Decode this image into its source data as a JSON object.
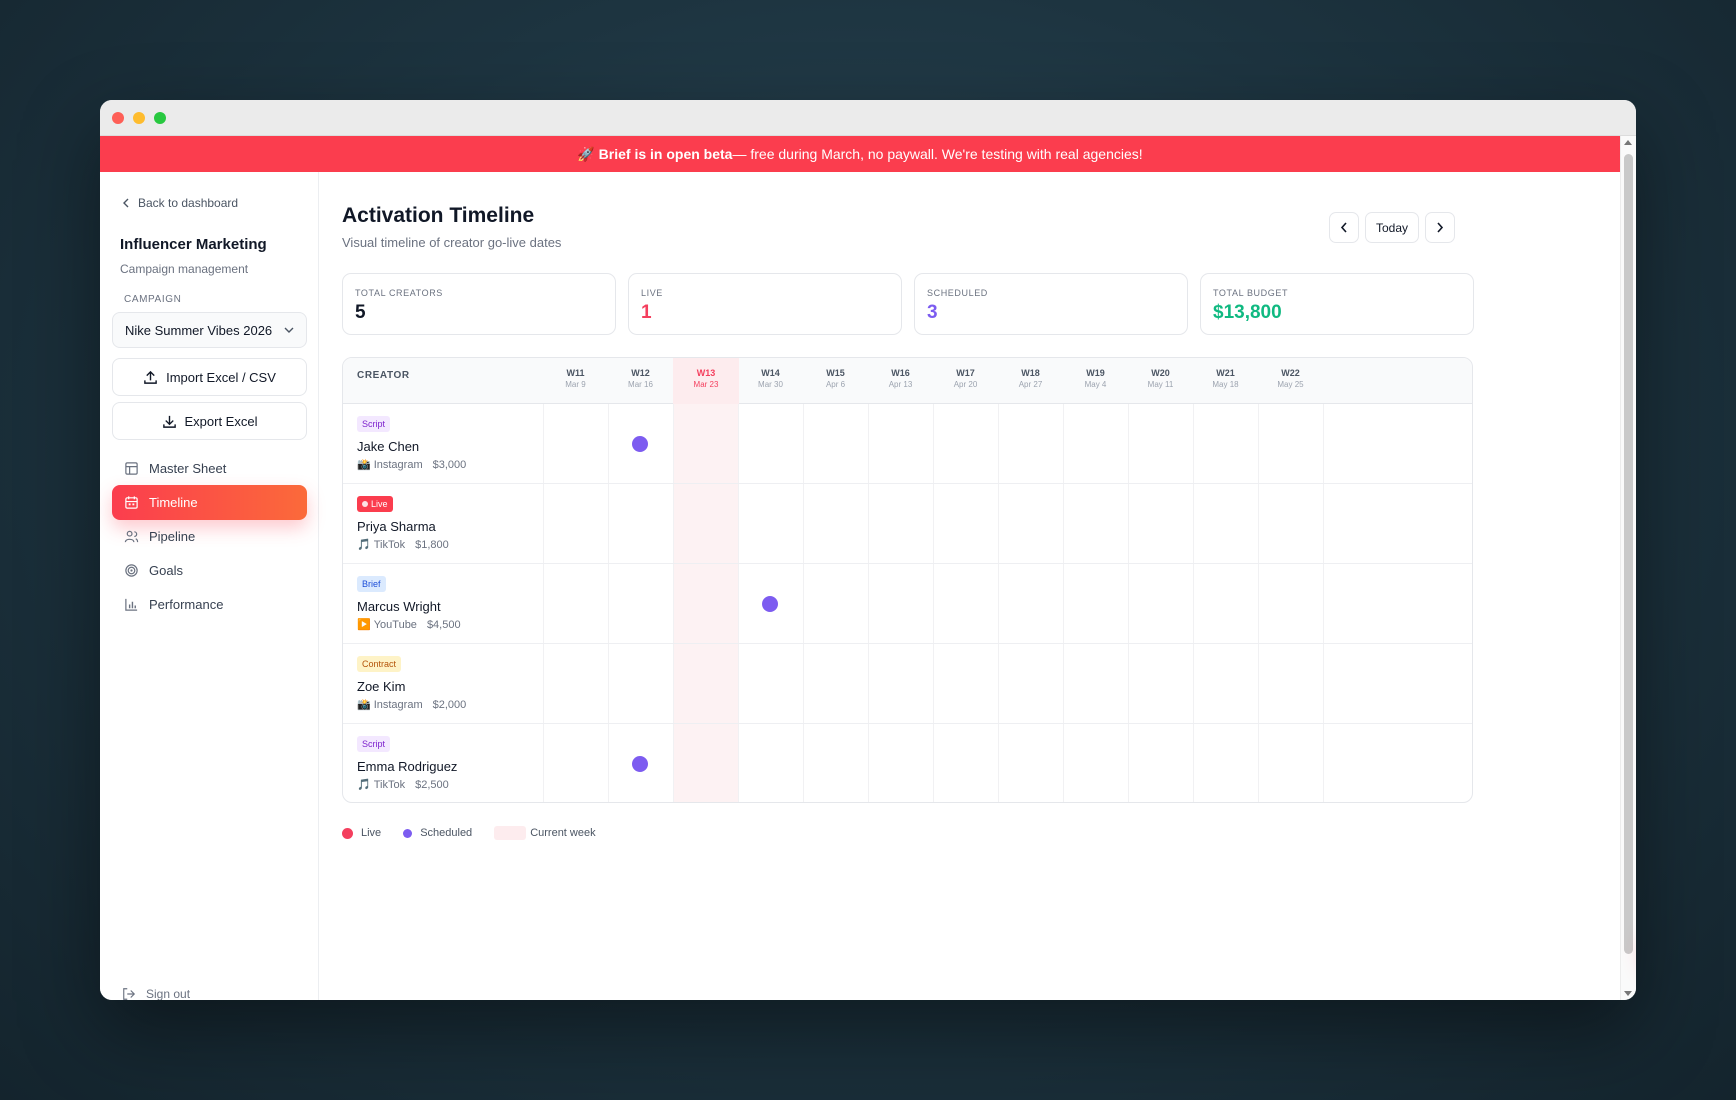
{
  "banner": {
    "emoji": "🚀",
    "bold": "Brief is in open beta",
    "rest": " — free during March, no paywall. We're testing with real agencies!"
  },
  "sidebar": {
    "back": "Back to dashboard",
    "title": "Influencer Marketing",
    "subtitle": "Campaign management",
    "campaign_label": "CAMPAIGN",
    "campaign_value": "Nike Summer Vibes 2026",
    "import_label": "Import Excel / CSV",
    "export_label": "Export Excel",
    "nav": [
      {
        "label": "Master Sheet",
        "icon": "table-icon",
        "active": false
      },
      {
        "label": "Timeline",
        "icon": "calendar-icon",
        "active": true
      },
      {
        "label": "Pipeline",
        "icon": "users-icon",
        "active": false
      },
      {
        "label": "Goals",
        "icon": "target-icon",
        "active": false
      },
      {
        "label": "Performance",
        "icon": "bar-chart-icon",
        "active": false
      }
    ],
    "signout": "Sign out"
  },
  "header": {
    "title": "Activation Timeline",
    "subtitle": "Visual timeline of creator go-live dates",
    "today": "Today"
  },
  "stats": [
    {
      "label": "TOTAL CREATORS",
      "value": "5",
      "color": "#111827"
    },
    {
      "label": "LIVE",
      "value": "1",
      "color": "#f43f5e"
    },
    {
      "label": "SCHEDULED",
      "value": "3",
      "color": "#7c5cf0"
    },
    {
      "label": "TOTAL BUDGET",
      "value": "$13,800",
      "color": "#10b981"
    }
  ],
  "timeline": {
    "creator_header": "CREATOR",
    "current_week": 2,
    "weeks": [
      {
        "w": "W11",
        "d": "Mar 9"
      },
      {
        "w": "W12",
        "d": "Mar 16"
      },
      {
        "w": "W13",
        "d": "Mar 23"
      },
      {
        "w": "W14",
        "d": "Mar 30"
      },
      {
        "w": "W15",
        "d": "Apr 6"
      },
      {
        "w": "W16",
        "d": "Apr 13"
      },
      {
        "w": "W17",
        "d": "Apr 20"
      },
      {
        "w": "W18",
        "d": "Apr 27"
      },
      {
        "w": "W19",
        "d": "May 4"
      },
      {
        "w": "W20",
        "d": "May 11"
      },
      {
        "w": "W21",
        "d": "May 18"
      },
      {
        "w": "W22",
        "d": "May 25"
      }
    ],
    "rows": [
      {
        "badge": "Script",
        "badge_type": "script",
        "name": "Jake Chen",
        "platform_icon": "📸",
        "platform": "Instagram",
        "budget": "$3,000",
        "scheduled_week": 1
      },
      {
        "badge": "Live",
        "badge_type": "live",
        "name": "Priya Sharma",
        "platform_icon": "🎵",
        "platform": "TikTok",
        "budget": "$1,800",
        "scheduled_week": null
      },
      {
        "badge": "Brief",
        "badge_type": "brief",
        "name": "Marcus Wright",
        "platform_icon": "▶️",
        "platform": "YouTube",
        "budget": "$4,500",
        "scheduled_week": 3
      },
      {
        "badge": "Contract",
        "badge_type": "contract",
        "name": "Zoe Kim",
        "platform_icon": "📸",
        "platform": "Instagram",
        "budget": "$2,000",
        "scheduled_week": null
      },
      {
        "badge": "Script",
        "badge_type": "script",
        "name": "Emma Rodriguez",
        "platform_icon": "🎵",
        "platform": "TikTok",
        "budget": "$2,500",
        "scheduled_week": 1
      }
    ]
  },
  "legend": {
    "live": "Live",
    "scheduled": "Scheduled",
    "current": "Current week",
    "live_color": "#f43f5e",
    "scheduled_color": "#7c5cf0"
  },
  "colors": {
    "accent": "#fb3d4e",
    "scheduled_dot": "#7c5cf0"
  }
}
